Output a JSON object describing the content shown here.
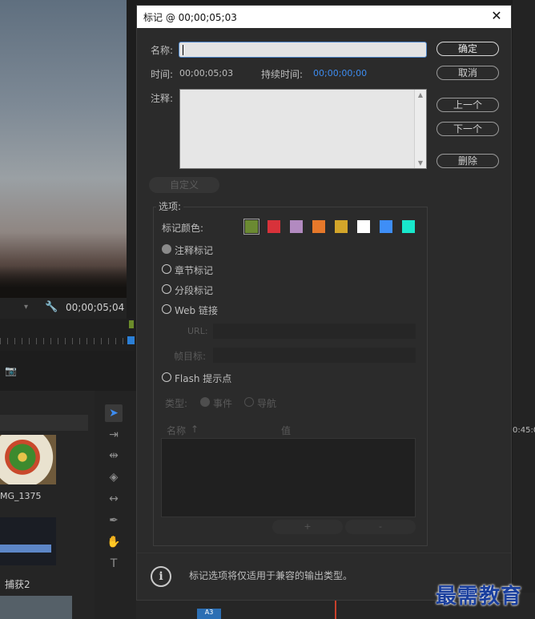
{
  "background": {
    "timecode": "00;00;05;04",
    "clip1_label": "MG_1375",
    "clip2_label": "捕获2",
    "timeline_tc": "0:45:0",
    "track_label": "A3"
  },
  "dialog": {
    "title": "标记 @ 00;00;05;03",
    "name_label": "名称:",
    "name_value": "",
    "time_label": "时间:",
    "time_value": "00;00;05;03",
    "duration_label": "持续时间:",
    "duration_value": "00;00;00;00",
    "comment_label": "注释:",
    "buttons": {
      "ok": "确定",
      "cancel": "取消",
      "prev": "上一个",
      "next": "下一个",
      "delete": "删除",
      "custom": "自定义"
    },
    "options_legend": "选项:",
    "marker_color_label": "标记颜色:",
    "colors": [
      "#6b8a32",
      "#d8323a",
      "#b28ac0",
      "#e6782a",
      "#d3a52a",
      "#ffffff",
      "#3e8ef7",
      "#18e8cc"
    ],
    "selected_color_index": 0,
    "marker_types": [
      {
        "label": "注释标记",
        "checked": true
      },
      {
        "label": "章节标记",
        "checked": false
      },
      {
        "label": "分段标记",
        "checked": false
      },
      {
        "label": "Web 链接",
        "checked": false
      }
    ],
    "url_label": "URL:",
    "frame_target_label": "帧目标:",
    "flash_label": "Flash 提示点",
    "type_label": "类型:",
    "type_event": "事件",
    "type_nav": "导航",
    "table_name_header": "名称",
    "table_value_header": "值",
    "add_button": "+",
    "remove_button": "-",
    "info_text": "标记选项将仅适用于兼容的输出类型。"
  },
  "watermark": "最需教育"
}
